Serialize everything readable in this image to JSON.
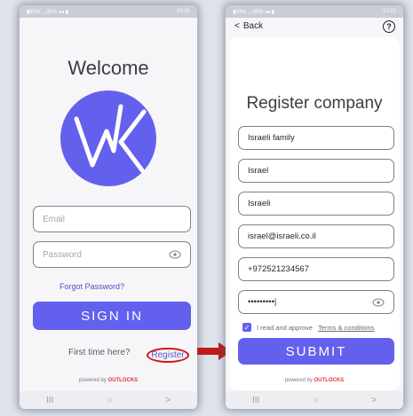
{
  "left_screen": {
    "status_left": "▮93% ◡35% ◂◂ ▮",
    "status_right": "10:01",
    "title": "Welcome",
    "email_placeholder": "Email",
    "password_placeholder": "Password",
    "forgot_password": "Forgot Password?",
    "sign_in": "SIGN IN",
    "first_time": "First time here?",
    "register_link": "Register",
    "powered_by": "powered by",
    "brand": "OUTLOCKS"
  },
  "right_screen": {
    "status_left": "▮93% ◡35% ◂◂ ▮",
    "status_right": "10:21",
    "back": "Back",
    "title": "Register company",
    "fields": {
      "company": "Israeli family",
      "country": "Israel",
      "name": "Israeli",
      "email": "israel@israeli.co.il",
      "phone": "+972521234567",
      "password": "•••••••••|"
    },
    "approve_text": "I read and approve",
    "terms_link": "Terms & conditions",
    "submit": "SUBMIT",
    "powered_by": "powered by",
    "brand": "OUTLOCKS"
  },
  "navbar": {
    "recent": "III",
    "home": "○",
    "back": ">"
  },
  "colors": {
    "primary": "#6460ee",
    "highlight": "#d21414",
    "brand": "#e8333a"
  },
  "icons": [
    "eye-icon",
    "chevron-left-icon",
    "question-icon",
    "check-icon",
    "arrow-right-icon",
    "wk-logo"
  ]
}
